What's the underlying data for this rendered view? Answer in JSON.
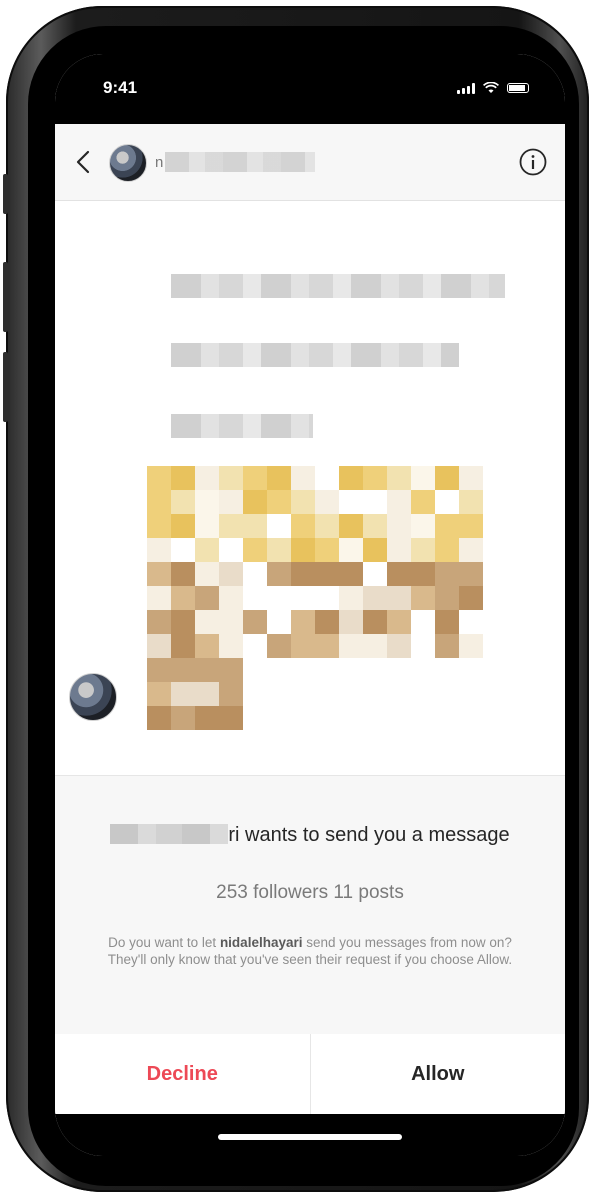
{
  "status_bar": {
    "time": "9:41"
  },
  "header": {
    "name_visible": "n"
  },
  "request": {
    "name_suffix": "ri",
    "title_rest": "wants to send you a message",
    "stats": "253 followers 11 posts",
    "desc_prefix": "Do you want to let",
    "desc_username": "nidalelhayari",
    "desc_suffix": "send you messages from now on? They'll only know that you've seen their request if you choose Allow."
  },
  "actions": {
    "decline": "Decline",
    "allow": "Allow"
  },
  "colors": {
    "decline": "#ed4956",
    "text": "#262626",
    "secondary": "#8e8e8e"
  }
}
